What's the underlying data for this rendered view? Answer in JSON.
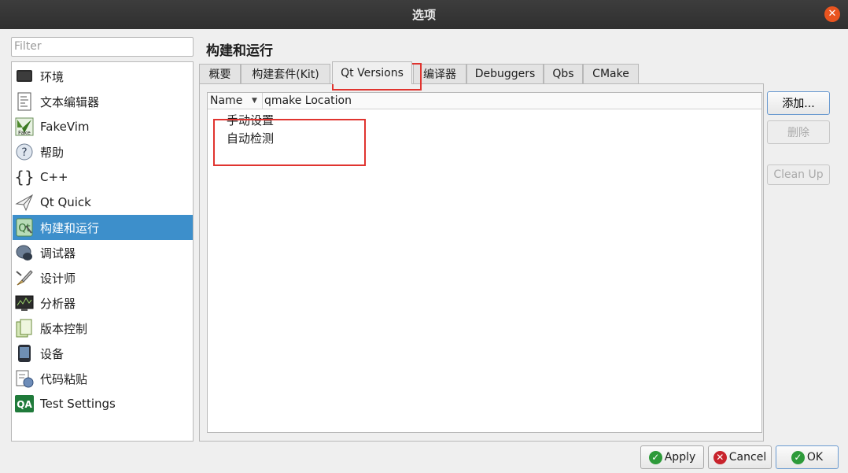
{
  "window": {
    "title": "选项"
  },
  "filter": {
    "placeholder": "Filter"
  },
  "sidebar": {
    "items": [
      {
        "label": "环境",
        "icon": "monitor-icon"
      },
      {
        "label": "文本编辑器",
        "icon": "text-document-icon"
      },
      {
        "label": "FakeVim",
        "icon": "fakevim-icon"
      },
      {
        "label": "帮助",
        "icon": "help-icon"
      },
      {
        "label": "C++",
        "icon": "braces-icon"
      },
      {
        "label": "Qt Quick",
        "icon": "paper-plane-icon"
      },
      {
        "label": "构建和运行",
        "icon": "build-run-icon",
        "selected": true
      },
      {
        "label": "调试器",
        "icon": "debugger-bug-icon"
      },
      {
        "label": "设计师",
        "icon": "design-brush-icon"
      },
      {
        "label": "分析器",
        "icon": "analyzer-icon"
      },
      {
        "label": "版本控制",
        "icon": "version-control-icon"
      },
      {
        "label": "设备",
        "icon": "device-icon"
      },
      {
        "label": "代码粘贴",
        "icon": "code-paste-icon"
      },
      {
        "label": "Test Settings",
        "icon": "qa-icon"
      }
    ]
  },
  "page": {
    "title": "构建和运行"
  },
  "tabs": [
    {
      "label": "概要"
    },
    {
      "label": "构建套件(Kit)"
    },
    {
      "label": "Qt Versions",
      "active": true
    },
    {
      "label": "编译器"
    },
    {
      "label": "Debuggers"
    },
    {
      "label": "Qbs"
    },
    {
      "label": "CMake"
    }
  ],
  "tree": {
    "columns": [
      "Name",
      "qmake Location"
    ],
    "rows": [
      "手动设置",
      "自动检测"
    ]
  },
  "side_buttons": {
    "add": "添加...",
    "remove": "删除",
    "cleanup": "Clean Up"
  },
  "footer": {
    "apply": "Apply",
    "cancel": "Cancel",
    "ok": "OK"
  },
  "colors": {
    "selection": "#3d8fcb",
    "highlight": "#e0342f",
    "titlebar": "#2f2f2f"
  }
}
